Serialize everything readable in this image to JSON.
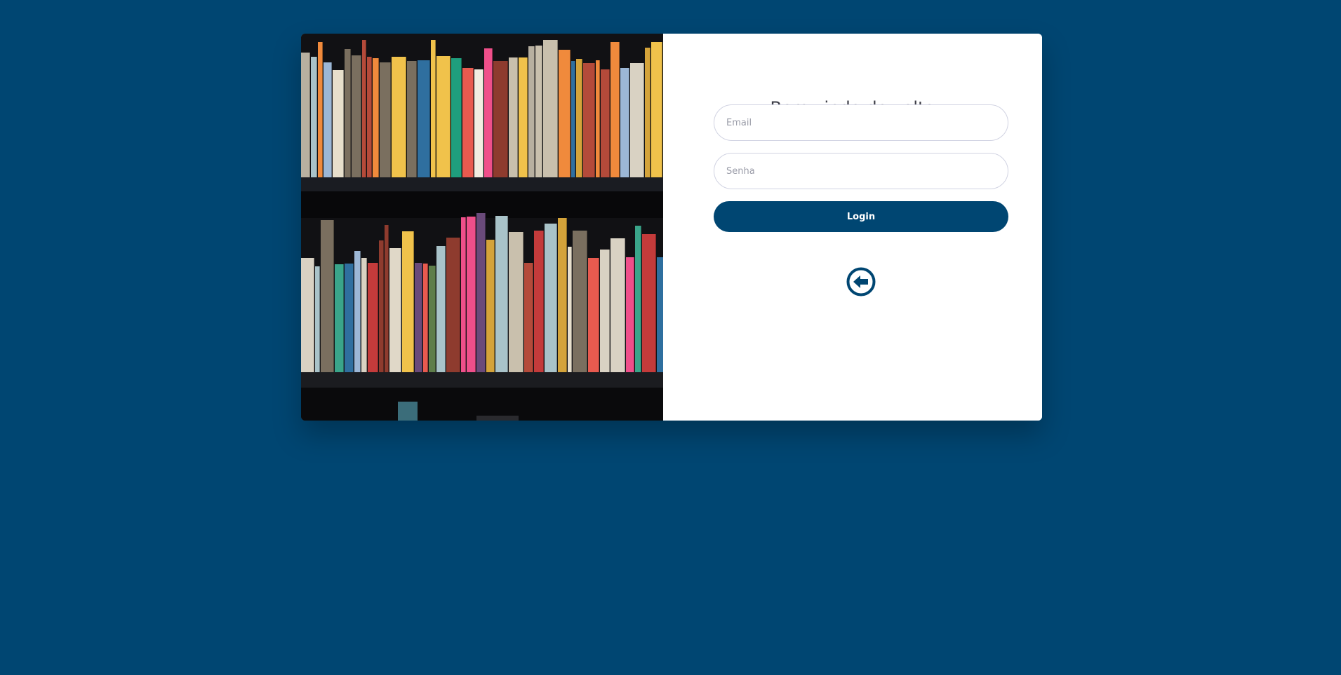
{
  "login": {
    "title": "Bem vindo de volta",
    "email_placeholder": "Email",
    "password_placeholder": "Senha",
    "login_label": "Login",
    "back_icon": "arrow-circle-left-icon"
  },
  "colors": {
    "background": "#004672",
    "accent": "#004672",
    "panel": "#ffffff"
  },
  "hero_image": "bookshelf-photo"
}
